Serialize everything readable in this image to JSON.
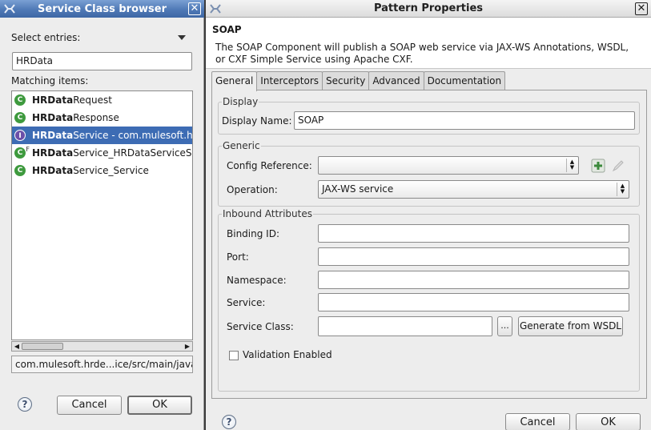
{
  "left_dialog": {
    "title": "Service Class browser",
    "close_glyph": "✕",
    "select_entries_label": "Select entries:",
    "search_value": "HRData",
    "matching_label": "Matching items:",
    "items": [
      {
        "bold": "HRData",
        "rest": "Request",
        "icon": "class-icon"
      },
      {
        "bold": "HRData",
        "rest": "Response",
        "icon": "class-icon"
      },
      {
        "bold": "HRData",
        "rest": "Service - com.mulesoft.hr",
        "icon": "interface-icon",
        "selected": true
      },
      {
        "bold": "HRData",
        "rest": "Service_HRDataServiceSO",
        "icon": "class-icon",
        "superscript": "F"
      },
      {
        "bold": "HRData",
        "rest": "Service_Service",
        "icon": "class-icon"
      }
    ],
    "path_text": "com.mulesoft.hrde...ice/src/main/java",
    "cancel_label": "Cancel",
    "ok_label": "OK",
    "help_glyph": "?"
  },
  "right_dialog": {
    "title": "Pattern Properties",
    "close_glyph": "✕",
    "header_title": "SOAP",
    "header_desc": "The SOAP Component will publish a SOAP web service via JAX-WS Annotations, WSDL, or CXF Simple Service using Apache CXF.",
    "tabs": [
      "General",
      "Interceptors",
      "Security",
      "Advanced",
      "Documentation"
    ],
    "display_group": "Display",
    "display_name_label": "Display Name:",
    "display_name_value": "SOAP",
    "generic_group": "Generic",
    "config_ref_label": "Config Reference:",
    "config_ref_value": "",
    "operation_label": "Operation:",
    "operation_value": "JAX-WS service",
    "inbound_group": "Inbound Attributes",
    "binding_id_label": "Binding ID:",
    "port_label": "Port:",
    "namespace_label": "Namespace:",
    "service_label": "Service:",
    "service_class_label": "Service Class:",
    "browse_label": "...",
    "generate_label": "Generate from WSDL",
    "validation_label": "Validation Enabled",
    "cancel_label": "Cancel",
    "ok_label": "OK",
    "help_glyph": "?"
  },
  "colors": {
    "titlebar_active": "#4f79b6",
    "selection": "#3d6cb4",
    "class_icon": "#3e9a3e",
    "interface_icon": "#6b4fa8"
  }
}
